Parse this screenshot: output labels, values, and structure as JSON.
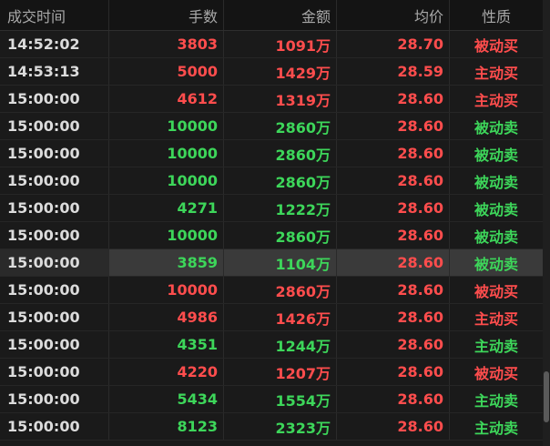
{
  "header": {
    "time": "成交时间",
    "volume": "手数",
    "amount": "金额",
    "avg_price": "均价",
    "property": "性质"
  },
  "rows": [
    {
      "time": "14:52:02",
      "volume": "3803",
      "amount": "1091万",
      "avg": "28.70",
      "prop": "被动买",
      "vol_color": "red",
      "amt_color": "red",
      "prop_color": "red"
    },
    {
      "time": "14:53:13",
      "volume": "5000",
      "amount": "1429万",
      "avg": "28.59",
      "prop": "主动买",
      "vol_color": "red",
      "amt_color": "red",
      "prop_color": "red"
    },
    {
      "time": "15:00:00",
      "volume": "4612",
      "amount": "1319万",
      "avg": "28.60",
      "prop": "主动买",
      "vol_color": "red",
      "amt_color": "red",
      "prop_color": "red"
    },
    {
      "time": "15:00:00",
      "volume": "10000",
      "amount": "2860万",
      "avg": "28.60",
      "prop": "被动卖",
      "vol_color": "green",
      "amt_color": "green",
      "prop_color": "green"
    },
    {
      "time": "15:00:00",
      "volume": "10000",
      "amount": "2860万",
      "avg": "28.60",
      "prop": "被动卖",
      "vol_color": "green",
      "amt_color": "green",
      "prop_color": "green"
    },
    {
      "time": "15:00:00",
      "volume": "10000",
      "amount": "2860万",
      "avg": "28.60",
      "prop": "被动卖",
      "vol_color": "green",
      "amt_color": "green",
      "prop_color": "green"
    },
    {
      "time": "15:00:00",
      "volume": "4271",
      "amount": "1222万",
      "avg": "28.60",
      "prop": "被动卖",
      "vol_color": "green",
      "amt_color": "green",
      "prop_color": "green"
    },
    {
      "time": "15:00:00",
      "volume": "10000",
      "amount": "2860万",
      "avg": "28.60",
      "prop": "被动卖",
      "vol_color": "green",
      "amt_color": "green",
      "prop_color": "green"
    },
    {
      "time": "15:00:00",
      "volume": "3859",
      "amount": "1104万",
      "avg": "28.60",
      "prop": "被动卖",
      "vol_color": "green",
      "amt_color": "green",
      "prop_color": "green",
      "selected": true
    },
    {
      "time": "15:00:00",
      "volume": "10000",
      "amount": "2860万",
      "avg": "28.60",
      "prop": "被动买",
      "vol_color": "red",
      "amt_color": "red",
      "prop_color": "red"
    },
    {
      "time": "15:00:00",
      "volume": "4986",
      "amount": "1426万",
      "avg": "28.60",
      "prop": "主动买",
      "vol_color": "red",
      "amt_color": "red",
      "prop_color": "red"
    },
    {
      "time": "15:00:00",
      "volume": "4351",
      "amount": "1244万",
      "avg": "28.60",
      "prop": "主动卖",
      "vol_color": "green",
      "amt_color": "green",
      "prop_color": "green"
    },
    {
      "time": "15:00:00",
      "volume": "4220",
      "amount": "1207万",
      "avg": "28.60",
      "prop": "被动买",
      "vol_color": "red",
      "amt_color": "red",
      "prop_color": "red"
    },
    {
      "time": "15:00:00",
      "volume": "5434",
      "amount": "1554万",
      "avg": "28.60",
      "prop": "主动卖",
      "vol_color": "green",
      "amt_color": "green",
      "prop_color": "green"
    },
    {
      "time": "15:00:00",
      "volume": "8123",
      "amount": "2323万",
      "avg": "28.60",
      "prop": "主动卖",
      "vol_color": "green",
      "amt_color": "green",
      "prop_color": "green"
    }
  ],
  "colors": {
    "red": "#ff4d4d",
    "green": "#3dd65a",
    "background": "#1a1a1a",
    "header_text": "#a8a8a8",
    "time_text": "#dcdcdc"
  }
}
